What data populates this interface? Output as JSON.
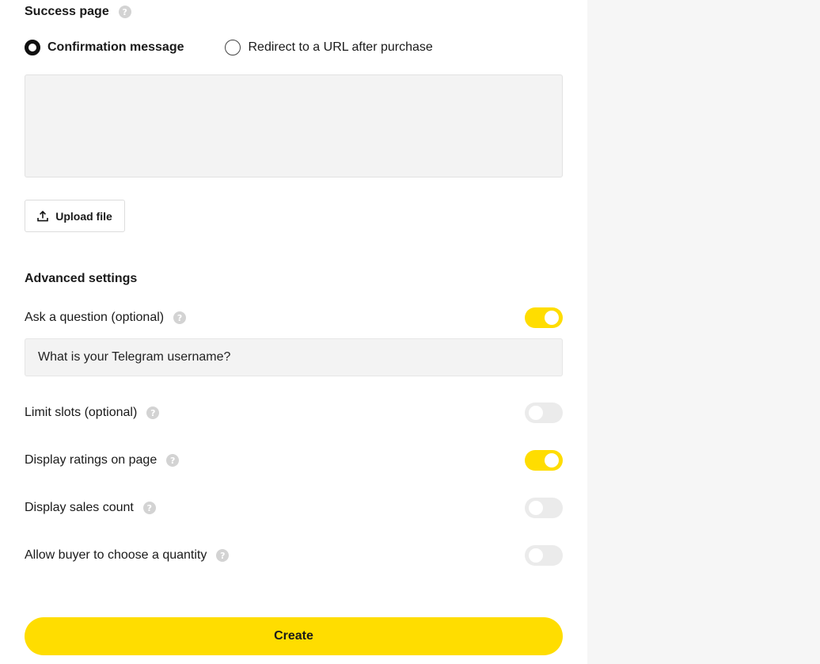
{
  "success_page": {
    "title": "Success page",
    "help_icon": "question-mark-icon",
    "options": [
      {
        "label": "Confirmation message",
        "selected": true
      },
      {
        "label": "Redirect to a URL after purchase",
        "selected": false
      }
    ],
    "message_value": "",
    "upload_label": "Upload file",
    "upload_icon": "upload-icon"
  },
  "advanced": {
    "title": "Advanced settings",
    "ask_question": {
      "label": "Ask a question (optional)",
      "enabled": true
    },
    "question_value": "What is your Telegram username?",
    "limit_slots": {
      "label": "Limit slots (optional)",
      "enabled": false
    },
    "display_ratings": {
      "label": "Display ratings on page",
      "enabled": true
    },
    "display_sales": {
      "label": "Display sales count",
      "enabled": false
    },
    "choose_quantity": {
      "label": "Allow buyer to choose a quantity",
      "enabled": false
    }
  },
  "create_label": "Create",
  "colors": {
    "accent": "#ffdd00",
    "toggle_off": "#ebebeb",
    "input_bg": "#f3f3f3",
    "side_panel": "#f6f6f6"
  }
}
